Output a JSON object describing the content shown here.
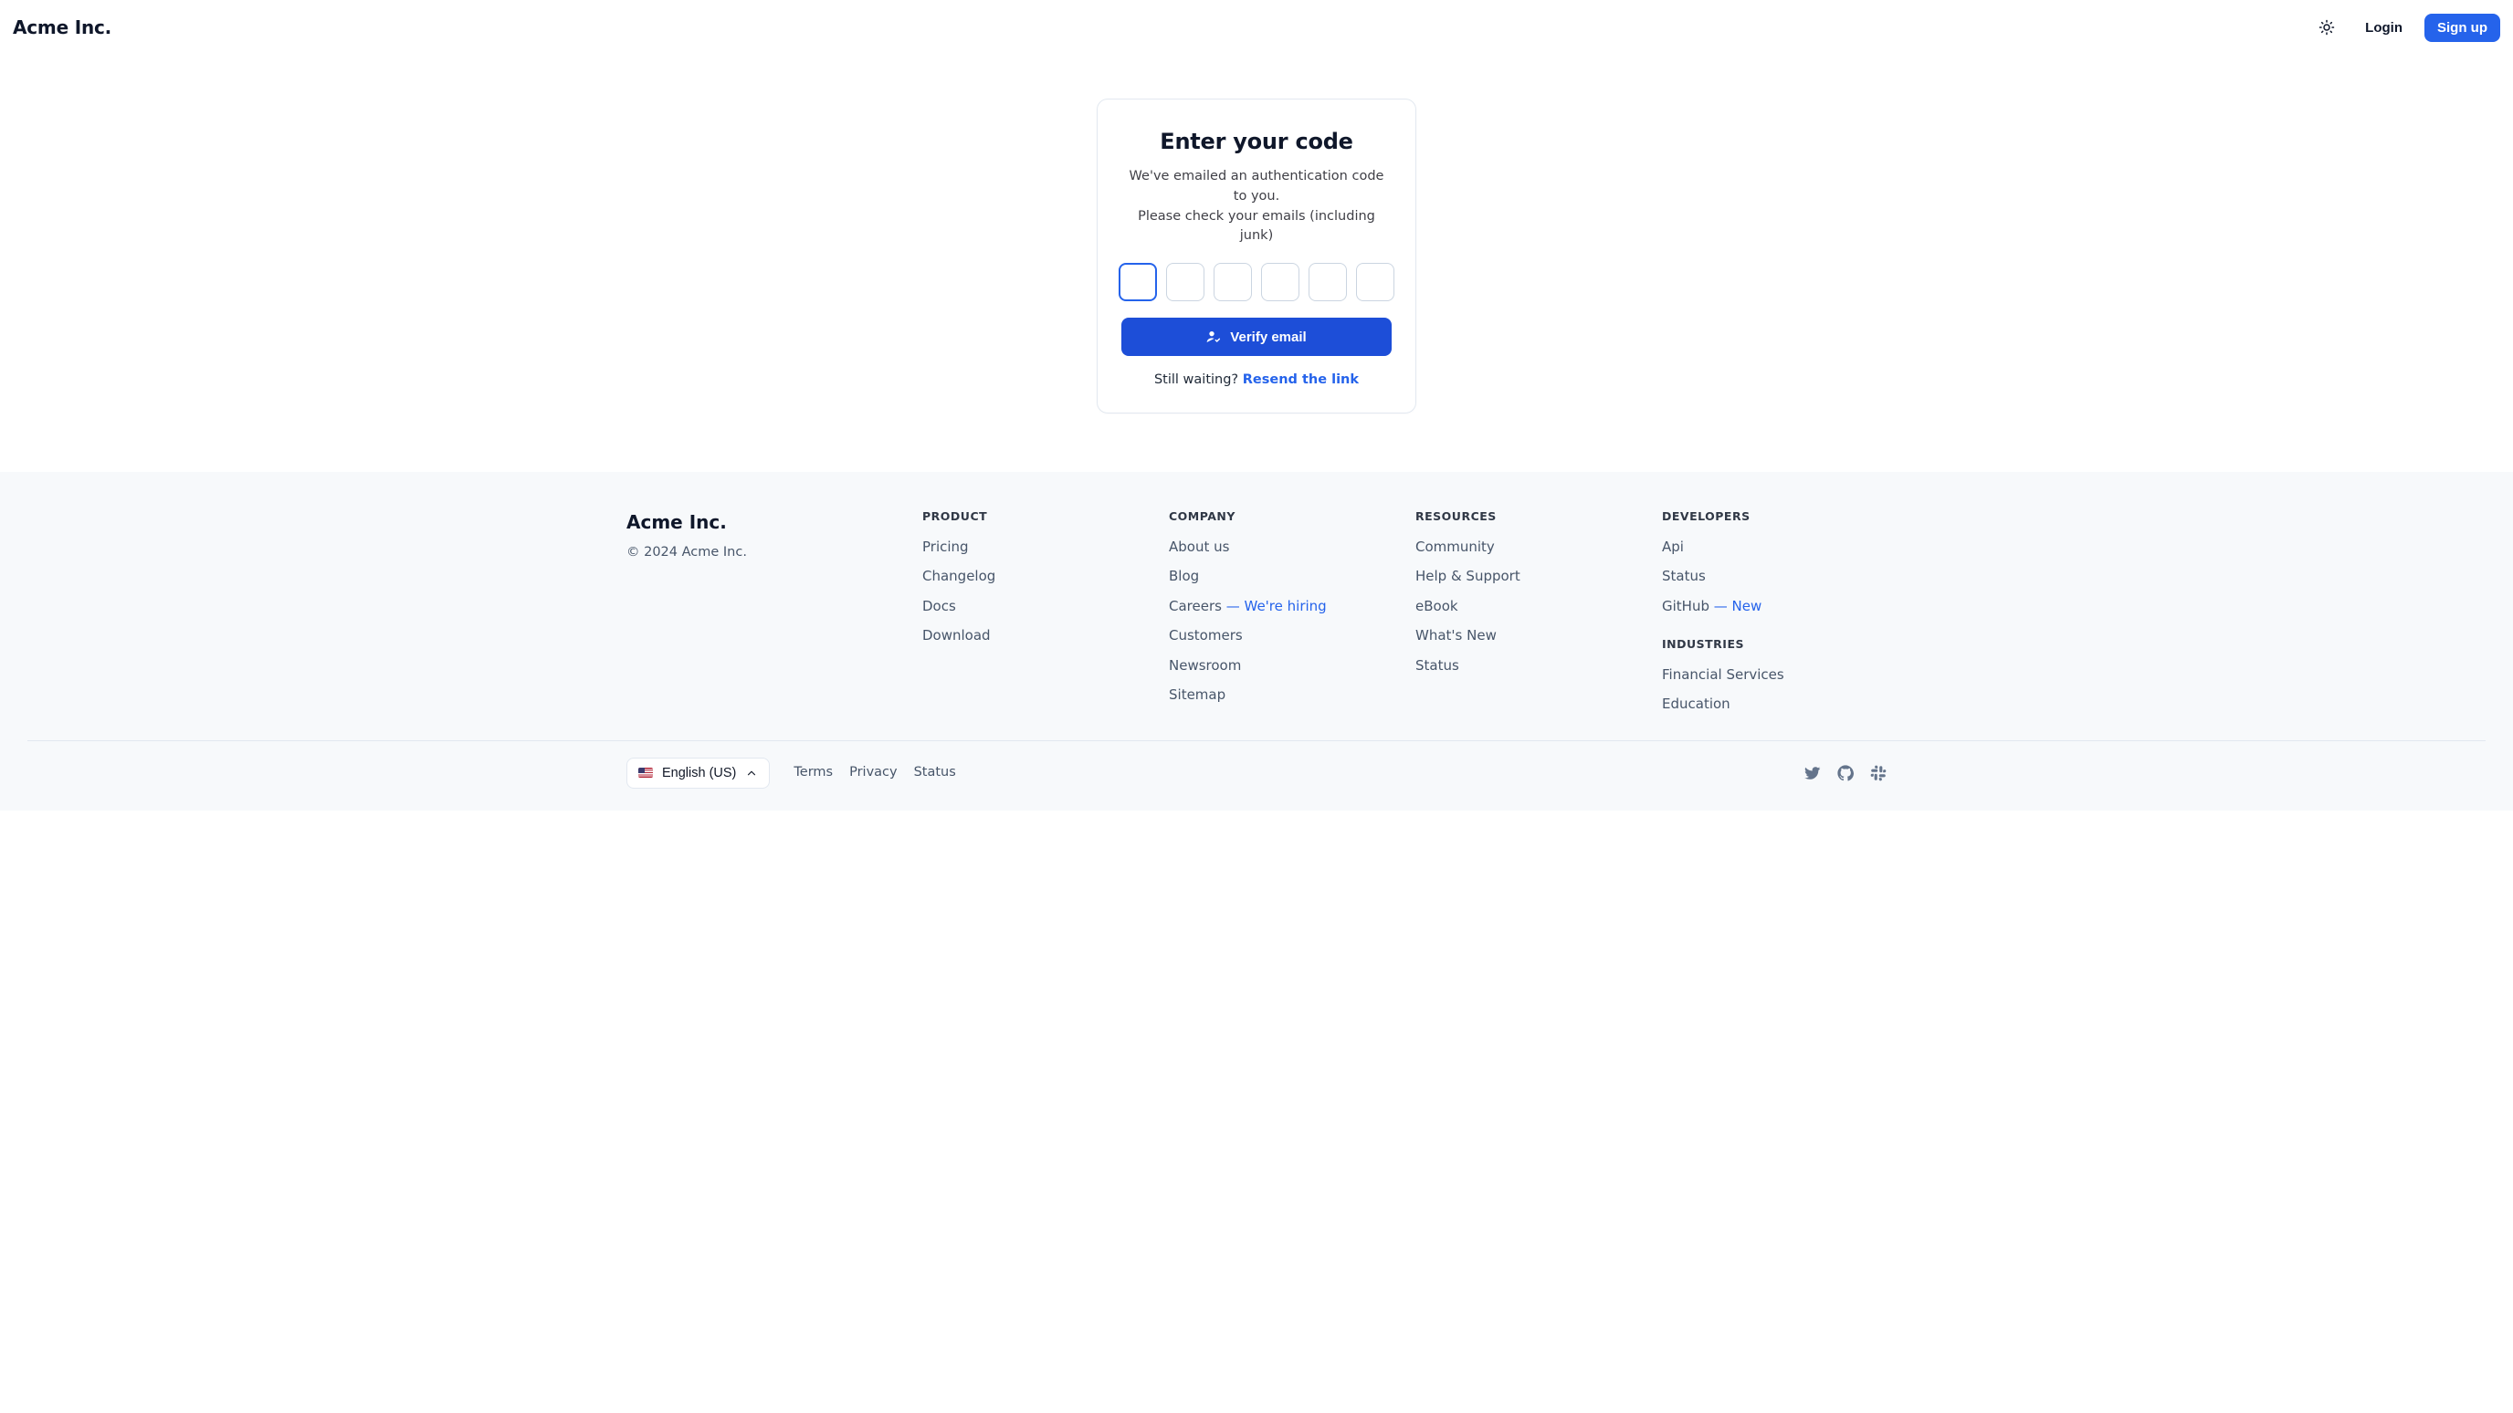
{
  "header": {
    "brand": "Acme Inc.",
    "login": "Login",
    "signup": "Sign up"
  },
  "card": {
    "title": "Enter your code",
    "subtitle_l1": "We've emailed an authentication code to you.",
    "subtitle_l2": "Please check your emails (including junk)",
    "verify": "Verify email",
    "waiting": "Still waiting? ",
    "resend": "Resend the link"
  },
  "footer": {
    "brand": "Acme Inc.",
    "copyright": "© 2024 Acme Inc.",
    "product": {
      "title": "PRODUCT",
      "items": [
        "Pricing",
        "Changelog",
        "Docs",
        "Download"
      ]
    },
    "company": {
      "title": "COMPANY",
      "items": [
        {
          "label": "About us"
        },
        {
          "label": "Blog"
        },
        {
          "label": "Careers",
          "note": "— We're hiring"
        },
        {
          "label": "Customers"
        },
        {
          "label": "Newsroom"
        },
        {
          "label": "Sitemap"
        }
      ]
    },
    "resources": {
      "title": "RESOURCES",
      "items": [
        "Community",
        "Help & Support",
        "eBook",
        "What's New",
        "Status"
      ]
    },
    "developers": {
      "title": "DEVELOPERS",
      "items": [
        {
          "label": "Api"
        },
        {
          "label": "Status"
        },
        {
          "label": "GitHub",
          "note": "— New"
        }
      ]
    },
    "industries": {
      "title": "INDUSTRIES",
      "items": [
        "Financial Services",
        "Education"
      ]
    }
  },
  "bottom": {
    "language": "English (US)",
    "links": [
      "Terms",
      "Privacy",
      "Status"
    ]
  }
}
